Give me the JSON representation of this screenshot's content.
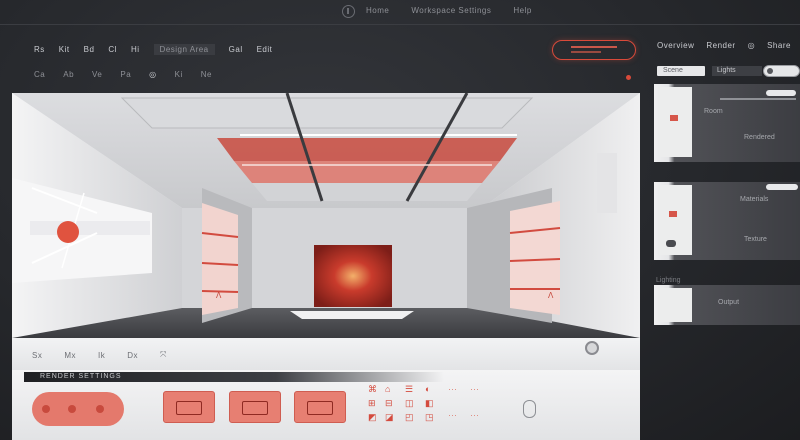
{
  "topbar": {
    "items": [
      "◦",
      "Home",
      "Workspace Settings",
      "Help"
    ]
  },
  "toolbar_row1": {
    "items": [
      "Rs",
      "Kit",
      "Bd",
      "Cl",
      "Hi",
      "Design Area",
      "Gal",
      "Edit"
    ]
  },
  "toolbar_row2": {
    "items": [
      "Ca",
      "Ab",
      "Ve",
      "Pa",
      "◎",
      "Ki",
      "Ne"
    ]
  },
  "cta": {
    "label": ""
  },
  "right_nav": {
    "items": [
      "Overview",
      "Render",
      "◎",
      "Share"
    ]
  },
  "side_panel": {
    "tabs": [
      "Scene",
      "Lights"
    ],
    "cards": [
      {
        "title": "Room",
        "meta": "Rendered"
      },
      {
        "title": "Materials",
        "meta": "Texture"
      },
      {
        "title": "Lighting",
        "meta": "Output"
      }
    ]
  },
  "controls": {
    "tools": [
      "Sx",
      "Mx",
      "Ik",
      "Dx",
      "⤧"
    ]
  },
  "bottom": {
    "strip_label": "RENDER SETTINGS"
  },
  "colors": {
    "accent": "#e4796c",
    "accent_dark": "#c84a3d",
    "dark_bg": "#26282c",
    "panel": "#efeff0"
  }
}
